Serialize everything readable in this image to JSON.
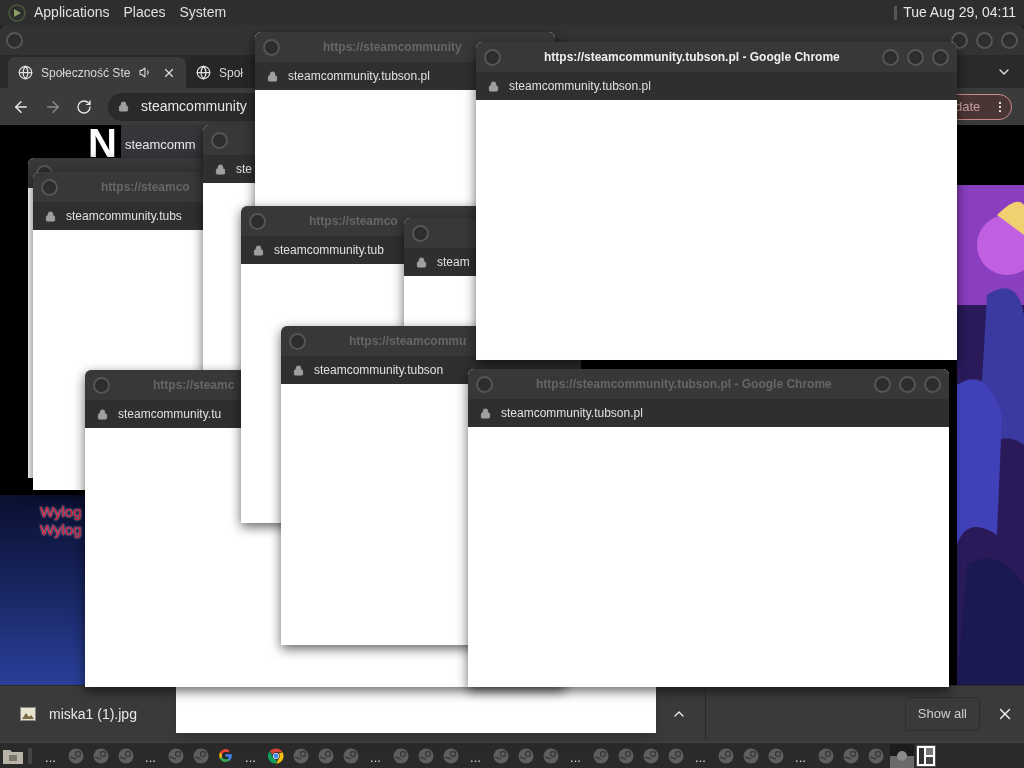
{
  "top_panel": {
    "menus": [
      "Applications",
      "Places",
      "System"
    ],
    "clock": "Tue Aug 29, 04:11"
  },
  "browser": {
    "tabs": [
      {
        "title": "Społeczność Ste",
        "audio": true,
        "selected": true
      },
      {
        "title": "Społ",
        "selected": false
      }
    ],
    "address": "steamcommunity",
    "update_button": "date",
    "page": {
      "heading_letter": "N",
      "overlay_text": "steamcomm",
      "notices": [
        "Wylog",
        "Wylog"
      ]
    }
  },
  "popups": [
    {
      "kind": "window"
    },
    {
      "title": "https://steamco",
      "url": "steamcommunity.tubs",
      "active": false
    },
    {
      "url": "ste"
    },
    {
      "title": "https://steamcommunity",
      "url": "steamcommunity.tubson.pl",
      "active": false
    },
    {
      "kind": "window_body"
    },
    {
      "title": "https://steamc",
      "url": "steamcommunity.tu",
      "active": false
    },
    {
      "title": "https://steamco",
      "url": "steamcommunity.tub",
      "active": false
    },
    {
      "url": "steam"
    },
    {
      "title": "https://steamcommu",
      "url": "steamcommunity.tubson",
      "active": false
    },
    {
      "title": "https://steamcommunity.tubson.pl - Google Chrome",
      "url": "steamcommunity.tubson.pl",
      "active": true
    },
    {
      "title": "https://steamcommunity.tubson.pl - Google Chrome",
      "url": "steamcommunity.tubson.pl",
      "active": false
    }
  ],
  "downloads": {
    "items": [
      {
        "name": "miska1 (1).jpg"
      }
    ],
    "show_all": "Show all"
  },
  "taskbar": {
    "items": [
      {
        "kind": "ellipsis",
        "text": "..."
      },
      {
        "kind": "app"
      },
      {
        "kind": "app"
      },
      {
        "kind": "app"
      },
      {
        "kind": "ellipsis",
        "text": "..."
      },
      {
        "kind": "app"
      },
      {
        "kind": "app"
      },
      {
        "kind": "google"
      },
      {
        "kind": "ellipsis",
        "text": "..."
      },
      {
        "kind": "chrome"
      },
      {
        "kind": "app"
      },
      {
        "kind": "app"
      },
      {
        "kind": "app"
      },
      {
        "kind": "ellipsis",
        "text": "..."
      },
      {
        "kind": "app"
      },
      {
        "kind": "app"
      },
      {
        "kind": "app"
      },
      {
        "kind": "ellipsis",
        "text": "..."
      },
      {
        "kind": "app"
      },
      {
        "kind": "app"
      },
      {
        "kind": "app"
      },
      {
        "kind": "ellipsis",
        "text": "..."
      },
      {
        "kind": "app"
      },
      {
        "kind": "app"
      },
      {
        "kind": "app"
      },
      {
        "kind": "app"
      },
      {
        "kind": "ellipsis",
        "text": "..."
      },
      {
        "kind": "app"
      },
      {
        "kind": "app"
      },
      {
        "kind": "app"
      },
      {
        "kind": "ellipsis",
        "text": "..."
      },
      {
        "kind": "app"
      },
      {
        "kind": "app"
      },
      {
        "kind": "app"
      },
      {
        "kind": "thumbnail"
      }
    ]
  }
}
